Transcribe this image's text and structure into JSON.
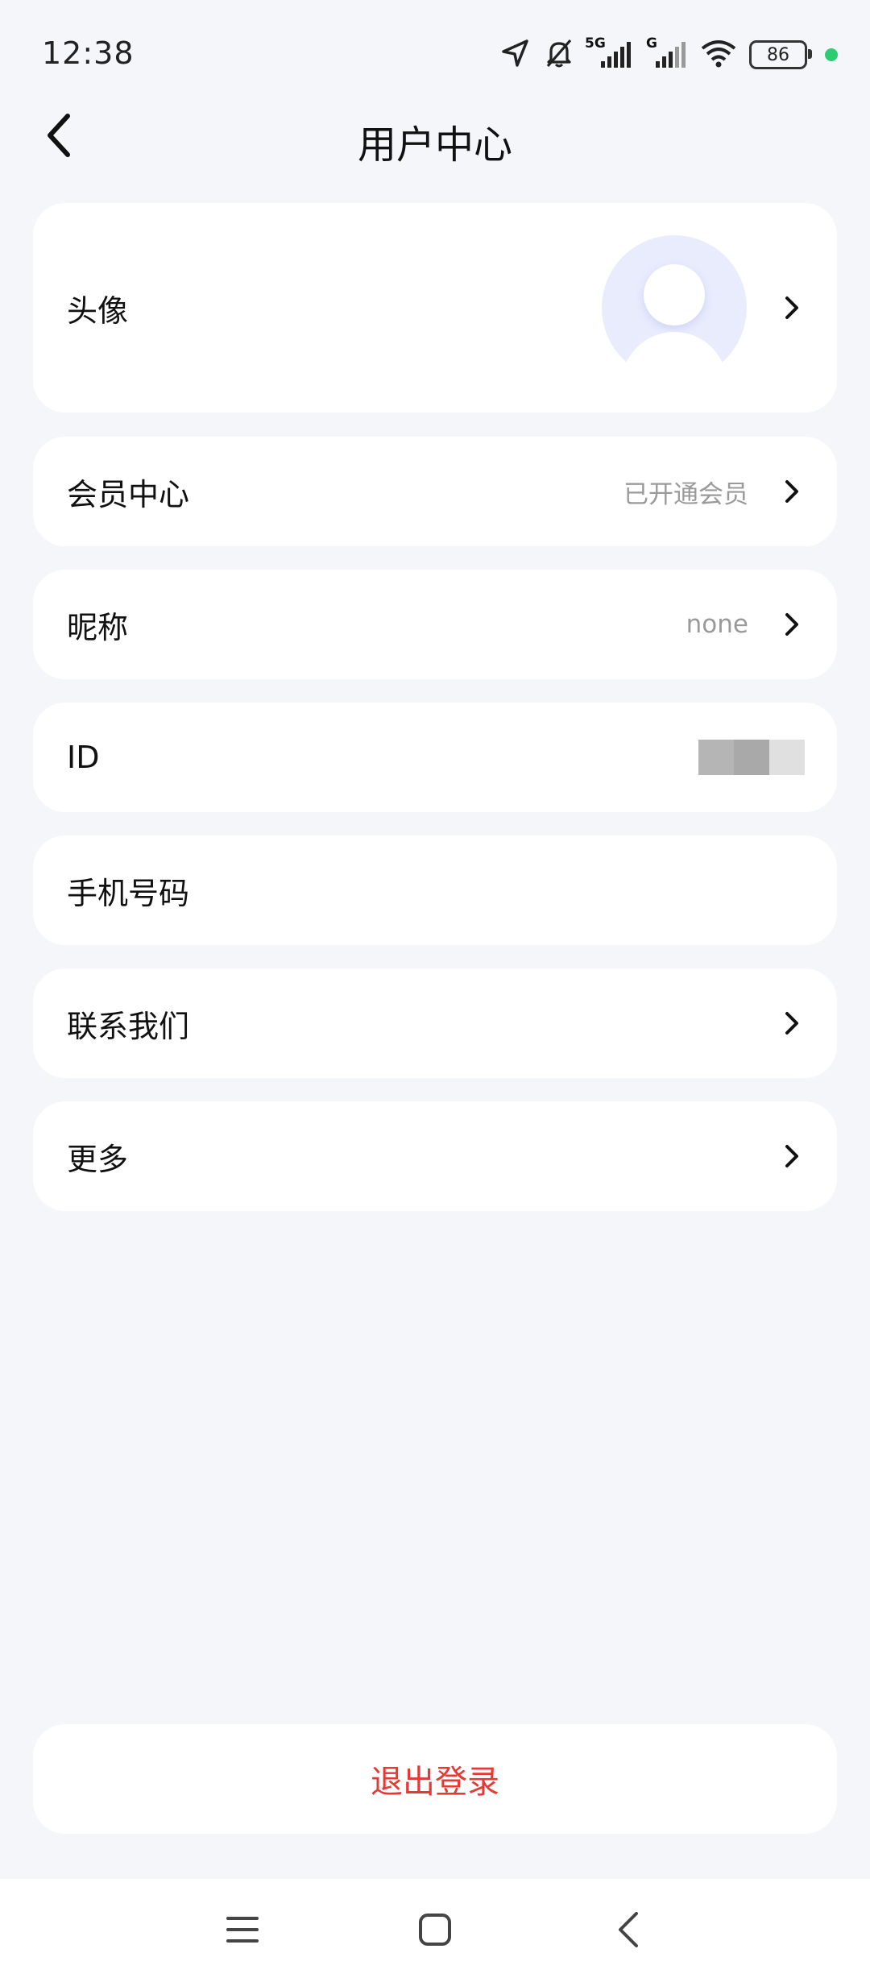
{
  "status_bar": {
    "time": "12:38",
    "battery_level": "86",
    "network_1": "5G",
    "network_2": "G",
    "icons": [
      "location-arrow-icon",
      "mute-bell-icon",
      "signal-icon",
      "signal-icon",
      "wifi-icon",
      "battery-icon",
      "green-dot-indicator"
    ]
  },
  "header": {
    "title": "用户中心",
    "back_icon": "chevron-left-icon"
  },
  "rows": {
    "avatar": {
      "label": "头像"
    },
    "membership": {
      "label": "会员中心",
      "value": "已开通会员"
    },
    "nickname": {
      "label": "昵称",
      "value": "none"
    },
    "id": {
      "label": "ID"
    },
    "phone": {
      "label": "手机号码"
    },
    "contact": {
      "label": "联系我们"
    },
    "more": {
      "label": "更多"
    }
  },
  "logout": {
    "label": "退出登录"
  },
  "colors": {
    "background": "#f5f6fa",
    "card": "#ffffff",
    "logout_text": "#e53935",
    "avatar_bg": "#e8ecfd"
  },
  "navbar": {
    "icons": [
      "menu-icon",
      "home-square-icon",
      "back-triangle-icon"
    ]
  }
}
